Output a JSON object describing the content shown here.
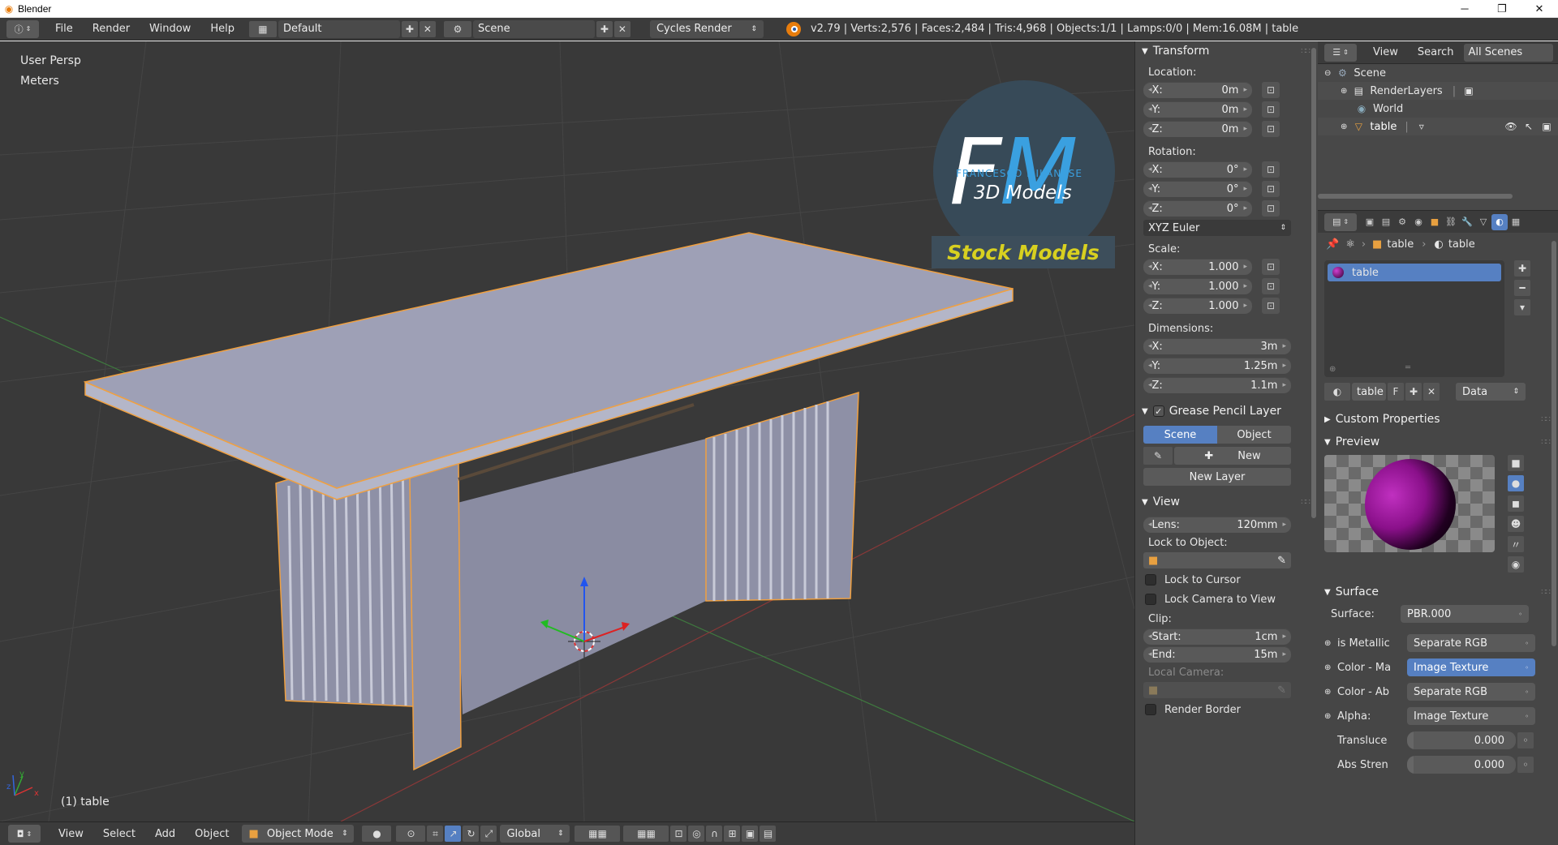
{
  "window": {
    "title": "Blender",
    "minimize": "─",
    "maximize": "❐",
    "close": "✕"
  },
  "infobar": {
    "menus": [
      "File",
      "Render",
      "Window",
      "Help"
    ],
    "screen_layout": "Default",
    "scene": "Scene",
    "render_engine": "Cycles Render",
    "stats": "v2.79 | Verts:2,576 | Faces:2,484 | Tris:4,968 | Objects:1/1 | Lamps:0/0 | Mem:16.08M | table"
  },
  "viewport": {
    "view_name": "User Persp",
    "units": "Meters",
    "object_label": "(1) table",
    "watermark": {
      "big": "FM",
      "name": "FRANCESCO MILANESE",
      "sub": "3D Models",
      "banner": "Stock Models"
    }
  },
  "viewport_footer": {
    "menus": [
      "View",
      "Select",
      "Add",
      "Object"
    ],
    "mode": "Object Mode",
    "orientation": "Global"
  },
  "npanel": {
    "transform": {
      "title": "Transform",
      "location_label": "Location:",
      "location": [
        {
          "axis": "X:",
          "value": "0m"
        },
        {
          "axis": "Y:",
          "value": "0m"
        },
        {
          "axis": "Z:",
          "value": "0m"
        }
      ],
      "rotation_label": "Rotation:",
      "rotation": [
        {
          "axis": "X:",
          "value": "0°"
        },
        {
          "axis": "Y:",
          "value": "0°"
        },
        {
          "axis": "Z:",
          "value": "0°"
        }
      ],
      "rotation_mode": "XYZ Euler",
      "scale_label": "Scale:",
      "scale": [
        {
          "axis": "X:",
          "value": "1.000"
        },
        {
          "axis": "Y:",
          "value": "1.000"
        },
        {
          "axis": "Z:",
          "value": "1.000"
        }
      ],
      "dimensions_label": "Dimensions:",
      "dimensions": [
        {
          "axis": "X:",
          "value": "3m"
        },
        {
          "axis": "Y:",
          "value": "1.25m"
        },
        {
          "axis": "Z:",
          "value": "1.1m"
        }
      ]
    },
    "grease_pencil": {
      "title": "Grease Pencil Layer",
      "scene_tab": "Scene",
      "object_tab": "Object",
      "new_button": "New",
      "new_layer_button": "New Layer"
    },
    "view": {
      "title": "View",
      "lens_label": "Lens:",
      "lens_value": "120mm",
      "lock_object_label": "Lock to Object:",
      "lock_cursor": "Lock to Cursor",
      "lock_camera": "Lock Camera to View",
      "clip_label": "Clip:",
      "clip_start_label": "Start:",
      "clip_start": "1cm",
      "clip_end_label": "End:",
      "clip_end": "15m",
      "local_camera_label": "Local Camera:",
      "render_border": "Render Border"
    }
  },
  "outliner": {
    "header": {
      "view": "View",
      "search": "Search",
      "filter": "All Scenes"
    },
    "items": [
      {
        "label": "Scene"
      },
      {
        "label": "RenderLayers"
      },
      {
        "label": "World"
      },
      {
        "label": "table"
      }
    ]
  },
  "properties": {
    "breadcrumb": [
      "table",
      "table"
    ],
    "material_slot": "table",
    "material_name": "table",
    "material_fake_user": "F",
    "link_mode": "Data",
    "custom_props": "Custom Properties",
    "preview": "Preview",
    "surface": {
      "title": "Surface",
      "surface_label": "Surface:",
      "surface_value": "PBR.000",
      "inputs": [
        {
          "label": "is Metallic",
          "value": "Separate RGB",
          "selected": false
        },
        {
          "label": "Color - Ma",
          "value": "Image Texture",
          "selected": true
        },
        {
          "label": "Color - Ab",
          "value": "Separate RGB",
          "selected": false
        },
        {
          "label": "Alpha:",
          "value": "Image Texture",
          "selected": false
        }
      ],
      "translucence_label": "Transluce",
      "translucence_value": "0.000",
      "abs_strength_label": "Abs Stren",
      "abs_strength_value": "0.000"
    }
  },
  "colors": {
    "viewport_bg": "#393939",
    "selection_outline": "#f0a040",
    "active_blue": "#5680c2",
    "table_face": "#9ea0b6",
    "watermark_blue": "#3aa0e0",
    "watermark_yellow": "#d8d020"
  }
}
